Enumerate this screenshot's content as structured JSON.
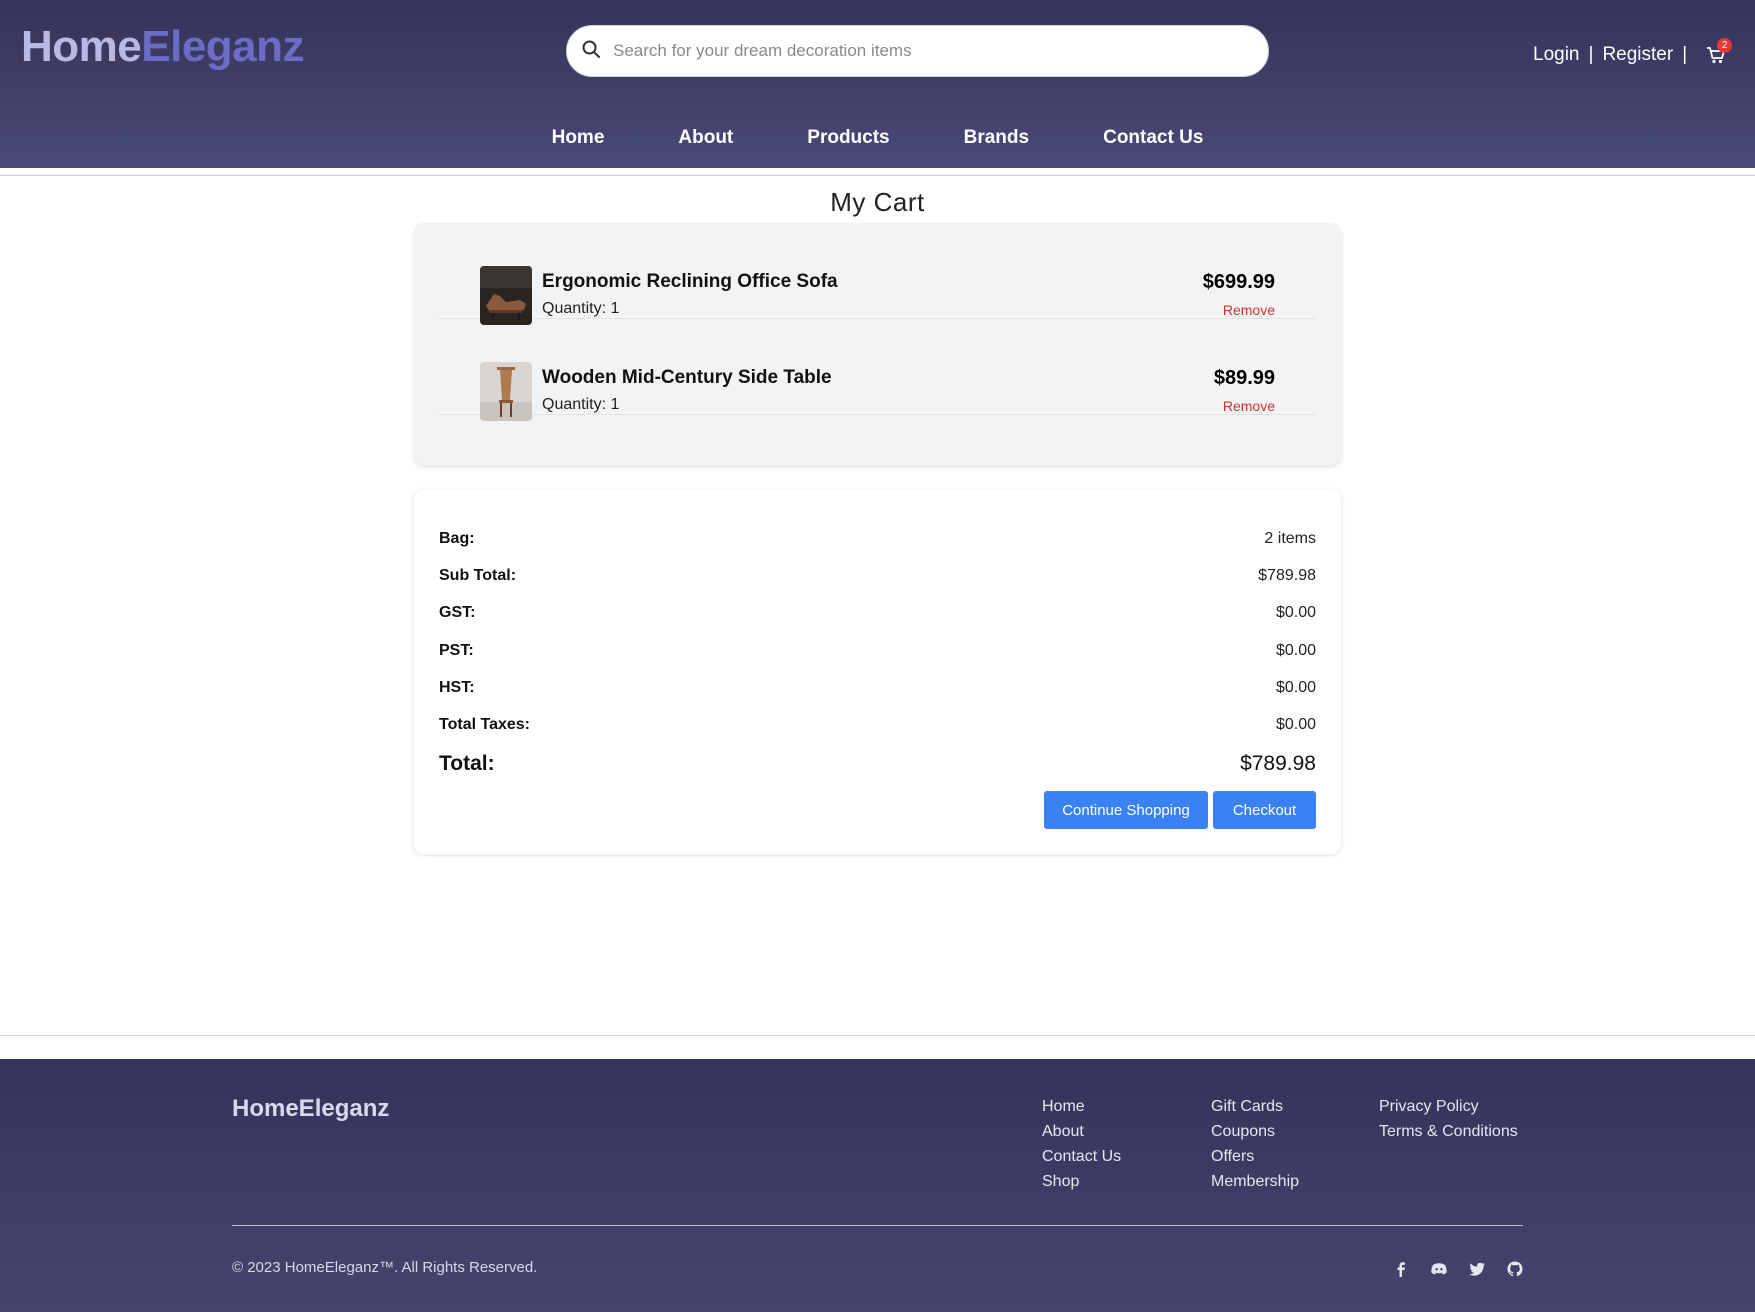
{
  "brand": {
    "part1": "Home",
    "part2": "Eleganz"
  },
  "search": {
    "placeholder": "Search for your dream decoration items"
  },
  "auth": {
    "login": "Login",
    "register": "Register",
    "separator": "|",
    "cart_count": "2"
  },
  "nav": {
    "items": [
      "Home",
      "About",
      "Products",
      "Brands",
      "Contact Us"
    ]
  },
  "cart": {
    "title": "My Cart",
    "items": [
      {
        "name": "Ergonomic Reclining Office Sofa",
        "quantity": "Quantity: 1",
        "price": "$699.99",
        "remove": "Remove"
      },
      {
        "name": "Wooden Mid-Century Side Table",
        "quantity": "Quantity: 1",
        "price": "$89.99",
        "remove": "Remove"
      }
    ]
  },
  "summary": {
    "rows": [
      {
        "label": "Bag:",
        "value": "2 items"
      },
      {
        "label": "Sub Total:",
        "value": "$789.98"
      },
      {
        "label": "GST:",
        "value": "$0.00"
      },
      {
        "label": "PST:",
        "value": "$0.00"
      },
      {
        "label": "HST:",
        "value": "$0.00"
      },
      {
        "label": "Total Taxes:",
        "value": "$0.00"
      }
    ],
    "total": {
      "label": "Total:",
      "value": "$789.98"
    },
    "continue_label": "Continue Shopping",
    "checkout_label": "Checkout"
  },
  "footer": {
    "brand": "HomeEleganz",
    "col1": [
      "Home",
      "About",
      "Contact Us",
      "Shop"
    ],
    "col2": [
      "Gift Cards",
      "Coupons",
      "Offers",
      "Membership"
    ],
    "col3": [
      "Privacy Policy",
      "Terms & Conditions"
    ],
    "copyright": "© 2023 HomeEleganz™. All Rights Reserved.",
    "socials": [
      "facebook-icon",
      "discord-icon",
      "twitter-icon",
      "github-icon"
    ]
  },
  "colors": {
    "header_bg": "#3f3f68",
    "logo_light": "#b9b9e6",
    "logo_accent": "#6c6cc4",
    "button": "#3a82f3",
    "remove": "#d32f2f",
    "badge": "#e53935"
  }
}
